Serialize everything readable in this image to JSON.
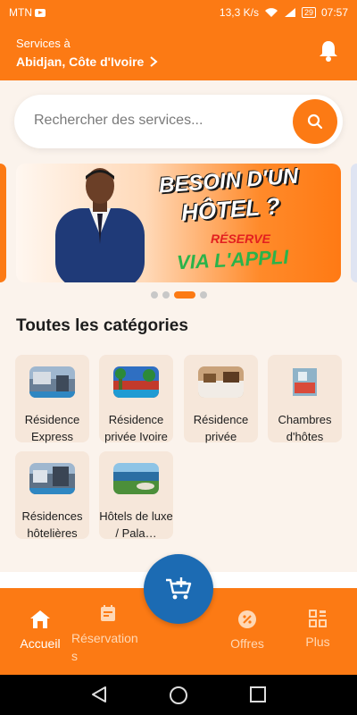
{
  "status_bar": {
    "carrier": "MTN",
    "speed": "13,3 K/s",
    "battery": "29",
    "time": "07:57"
  },
  "header": {
    "location_label": "Services à",
    "location_value": "Abidjan, Côte d'Ivoire"
  },
  "search": {
    "placeholder": "Rechercher des services..."
  },
  "banner": {
    "line1": "BESOIN D'UN",
    "line2": "HÔTEL ?",
    "line3": "RÉSERVE",
    "line4": "VIA L'APPLI"
  },
  "carousel": {
    "count": 4,
    "active_index": 2
  },
  "categories_title": "Toutes les catégories",
  "categories": [
    {
      "label": "Résidence Express"
    },
    {
      "label": "Résidence privée Ivoire"
    },
    {
      "label": "Résidence privée"
    },
    {
      "label": "Chambres d'hôtes"
    },
    {
      "label": "Résidences hôtelières"
    },
    {
      "label": "Hôtels de luxe / Pala…"
    }
  ],
  "bottom_nav": {
    "home": "Accueil",
    "reservations_line1": "Réservation",
    "reservations_line2": "s",
    "offers": "Offres",
    "more": "Plus"
  },
  "colors": {
    "brand": "#fc7a14",
    "fab": "#1c6bb3"
  }
}
